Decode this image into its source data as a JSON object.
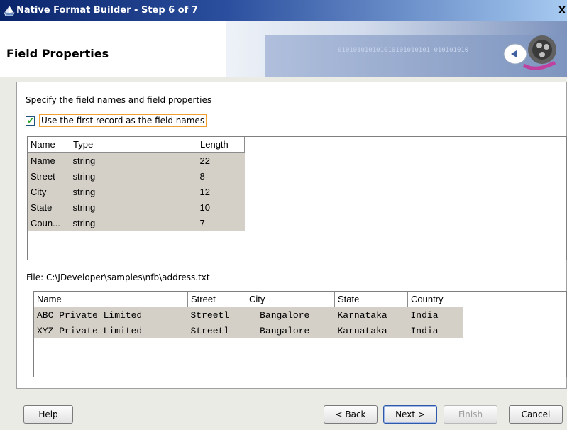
{
  "window": {
    "title": "Native Format Builder - Step 6 of 7",
    "close_glyph": "X"
  },
  "header": {
    "title": "Field Properties",
    "banner_binary": "010101010101010101010101 010101010"
  },
  "content": {
    "instruction": "Specify the field names and field properties",
    "use_first_record": {
      "checked": true,
      "label": "Use the first record as the field names"
    },
    "fields_table": {
      "columns": [
        "Name",
        "Type",
        "Length"
      ],
      "rows": [
        [
          "Name",
          "string",
          "22"
        ],
        [
          "Street",
          "string",
          "8"
        ],
        [
          "City",
          "string",
          "12"
        ],
        [
          "State",
          "string",
          "10"
        ],
        [
          "Coun...",
          "string",
          "7"
        ]
      ]
    },
    "file_label": "File: C:\\JDeveloper\\samples\\nfb\\address.txt",
    "preview_table": {
      "columns": [
        "Name",
        "Street",
        "City",
        "State",
        "Country"
      ],
      "rows": [
        [
          "ABC Private Limited",
          "Streetl",
          "  Bangalore",
          "Karnataka",
          "India"
        ],
        [
          "XYZ Private Limited",
          "Streetl",
          "  Bangalore",
          "Karnataka",
          "India"
        ]
      ]
    }
  },
  "footer": {
    "help": "Help",
    "back": "< Back",
    "next": "Next >",
    "finish": "Finish",
    "cancel": "Cancel"
  },
  "colors": {
    "selection": "#d4d0c8",
    "titlebar": "#0a246a"
  }
}
